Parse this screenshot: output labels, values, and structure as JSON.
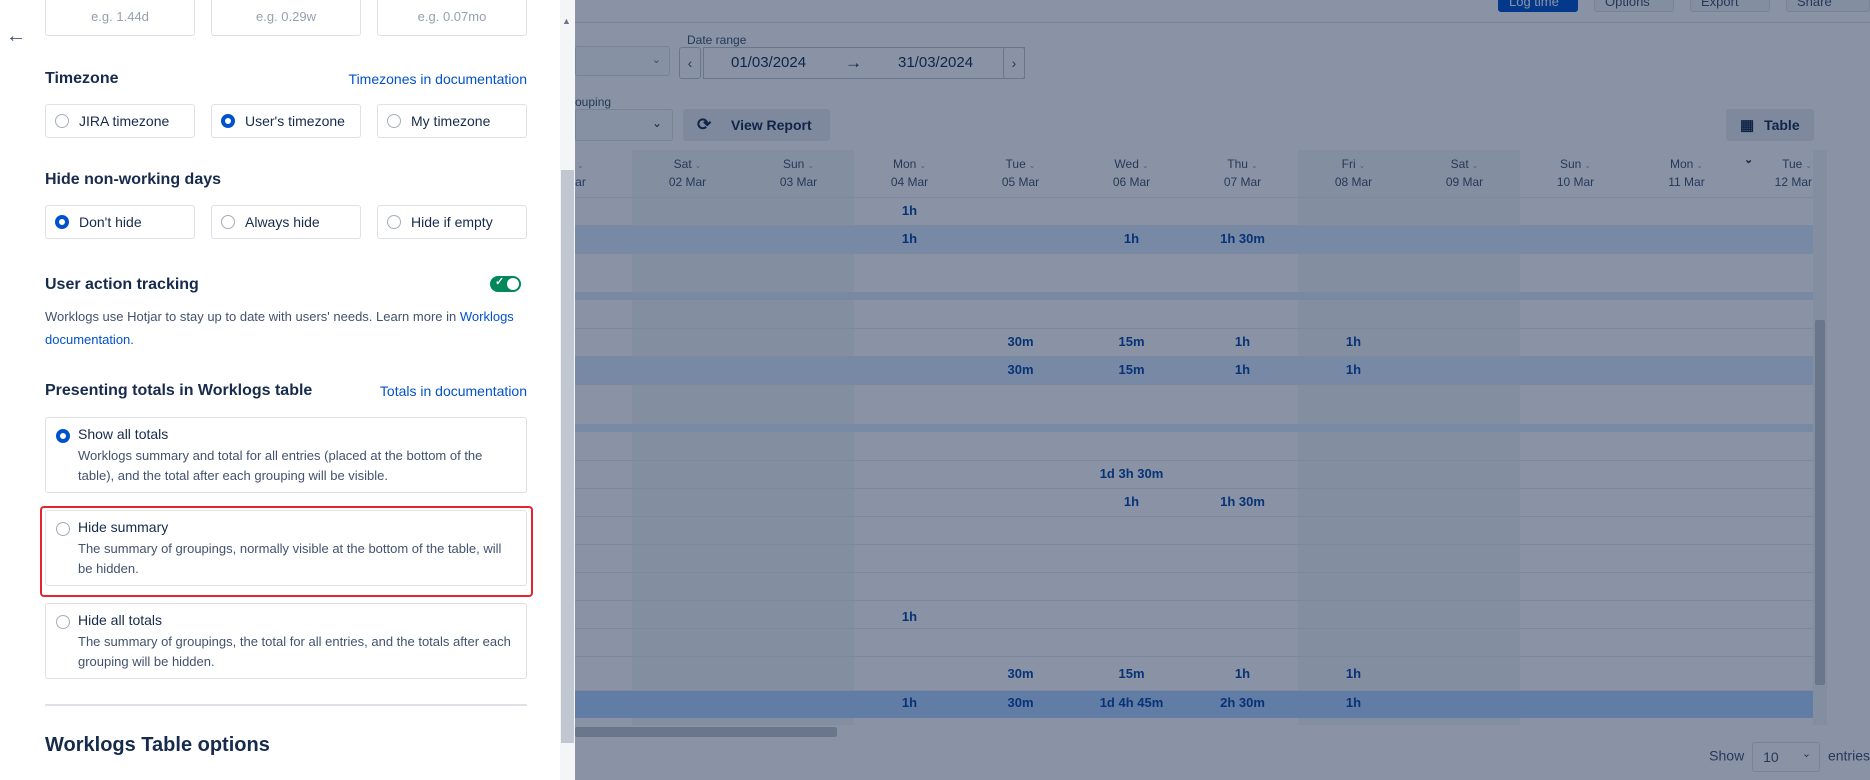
{
  "topbar": {
    "log_time": "Log time",
    "options": "Options",
    "export": "Export",
    "share": "Share"
  },
  "controls": {
    "date_range_label": "Date range",
    "date_from": "01/03/2024",
    "date_to": "31/03/2024",
    "grouping_label": "ouping",
    "view_report": "View Report",
    "table": "Table"
  },
  "columns": [
    {
      "day": "ri",
      "date": "Mar"
    },
    {
      "day": "Sat",
      "date": "02 Mar"
    },
    {
      "day": "Sun",
      "date": "03 Mar"
    },
    {
      "day": "Mon",
      "date": "04 Mar"
    },
    {
      "day": "Tue",
      "date": "05 Mar"
    },
    {
      "day": "Wed",
      "date": "06 Mar"
    },
    {
      "day": "Thu",
      "date": "07 Mar"
    },
    {
      "day": "Fri",
      "date": "08 Mar"
    },
    {
      "day": "Sat",
      "date": "09 Mar"
    },
    {
      "day": "Sun",
      "date": "10 Mar"
    },
    {
      "day": "Mon",
      "date": "11 Mar"
    },
    {
      "day": "Tue",
      "date": "12 Mar"
    }
  ],
  "rows": {
    "r1": {
      "mon04": "1h"
    },
    "r2": {
      "mon04": "1h",
      "wed06": "1h",
      "thu07": "1h 30m"
    },
    "r3": {
      "tue05": "30m",
      "wed06": "15m",
      "thu07": "1h",
      "fri08": "1h"
    },
    "r4": {
      "tue05": "30m",
      "wed06": "15m",
      "thu07": "1h",
      "fri08": "1h"
    },
    "r5": {
      "wed06": "1d 3h 30m"
    },
    "r6": {
      "wed06": "1h",
      "thu07": "1h 30m"
    },
    "r7": {
      "mon04": "1h"
    },
    "r8": {
      "tue05": "30m",
      "wed06": "15m",
      "thu07": "1h",
      "fri08": "1h"
    },
    "r9": {
      "mon04": "1h",
      "tue05": "30m",
      "wed06": "1d 4h 45m",
      "thu07": "2h 30m",
      "fri08": "1h"
    }
  },
  "footer": {
    "show": "Show",
    "entries_value": "10",
    "entries": "entries"
  },
  "panel": {
    "inputs": [
      "e.g. 1.44d",
      "e.g. 0.29w",
      "e.g. 0.07mo"
    ],
    "timezone": {
      "title": "Timezone",
      "link": "Timezones in documentation",
      "options": [
        "JIRA timezone",
        "User's timezone",
        "My timezone"
      ],
      "selected": "User's timezone"
    },
    "nonworking": {
      "title": "Hide non-working days",
      "options": [
        "Don't hide",
        "Always hide",
        "Hide if empty"
      ],
      "selected": "Don't hide"
    },
    "tracking": {
      "title": "User action tracking",
      "enabled": true,
      "desc_pre": "Worklogs use Hotjar to stay up to date with users' needs. Learn more in",
      "desc_link": "Worklogs documentation",
      "desc_post": "."
    },
    "totals": {
      "title": "Presenting totals in Worklogs table",
      "link": "Totals in documentation",
      "options": [
        {
          "title": "Show all totals",
          "desc": "Worklogs summary and total for all entries (placed at the bottom of the table), and the total after each grouping will be visible."
        },
        {
          "title": "Hide summary",
          "desc": "The summary of groupings, normally visible at the bottom of the table, will be hidden."
        },
        {
          "title": "Hide all totals",
          "desc": "The summary of groupings, the total for all entries, and the totals after each grouping will be hidden."
        }
      ],
      "selected": "Show all totals"
    },
    "table_options_title": "Worklogs Table options"
  }
}
